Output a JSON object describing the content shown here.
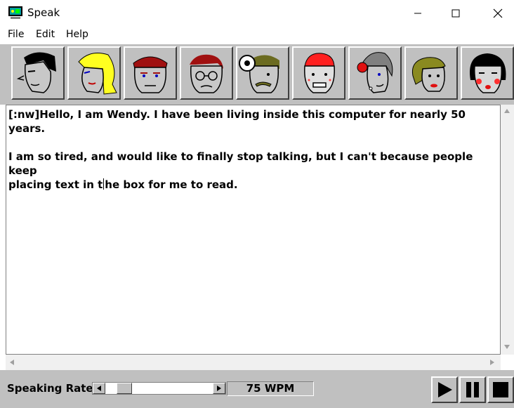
{
  "window": {
    "title": "Speak",
    "controls": [
      "minimize",
      "maximize",
      "close"
    ]
  },
  "menu": {
    "items": [
      "File",
      "Edit",
      "Help"
    ]
  },
  "voices": [
    {
      "icon": "man-dark-hair-face-icon"
    },
    {
      "icon": "woman-blonde-face-icon"
    },
    {
      "icon": "man-red-hair-face-icon"
    },
    {
      "icon": "old-man-glasses-face-icon"
    },
    {
      "icon": "man-mustache-head-mirror-face-icon"
    },
    {
      "icon": "child-red-hair-face-icon"
    },
    {
      "icon": "old-woman-gray-hair-face-icon"
    },
    {
      "icon": "woman-olive-hair-face-icon"
    },
    {
      "icon": "woman-black-bob-face-icon"
    }
  ],
  "editor": {
    "line1": "[:nw]Hello, I am Wendy. I have been living inside this computer for nearly 50 years.",
    "line2": "I am so tired, and would like to finally stop talking, but I can't because people keep",
    "line3_before_caret": "placing text in t",
    "line3_after_caret": "he box for me to read."
  },
  "status": {
    "speaking_rate_label": "Speaking Rate",
    "rate_value": "75 WPM",
    "rate_slider_position": 0.12
  },
  "playback": {
    "buttons": [
      "play",
      "pause",
      "stop"
    ]
  },
  "colors": {
    "panel": "#c0c0c0",
    "editor_bg": "#ffffff"
  }
}
